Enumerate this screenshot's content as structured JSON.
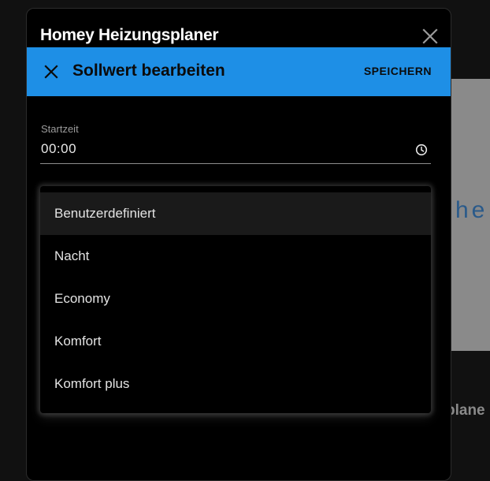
{
  "background": {
    "card_text": "he",
    "bottom_text": "plane"
  },
  "dialog": {
    "title": "Homey Heizungsplaner",
    "close_icon": "close-icon"
  },
  "toolbar": {
    "title": "Sollwert bearbeiten",
    "save_label": "SPEICHERN",
    "close_icon": "close-icon",
    "accent_color": "#1e8fe6"
  },
  "start_time": {
    "label": "Startzeit",
    "value": "00:00",
    "icon": "clock-icon"
  },
  "preset_menu": {
    "selected": "Benutzerdefiniert",
    "items": [
      {
        "label": "Benutzerdefiniert"
      },
      {
        "label": "Nacht"
      },
      {
        "label": "Economy"
      },
      {
        "label": "Komfort"
      },
      {
        "label": "Komfort plus"
      }
    ]
  }
}
